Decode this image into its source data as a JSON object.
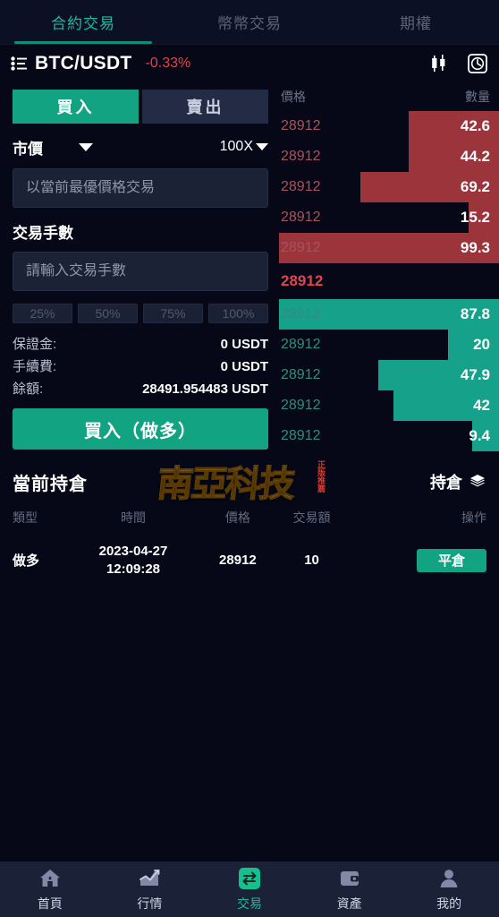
{
  "top_tabs": [
    {
      "label": "合約交易",
      "active": true
    },
    {
      "label": "幣幣交易",
      "active": false
    },
    {
      "label": "期權",
      "active": false
    }
  ],
  "symbol_header": {
    "menu_icon": "list-menu-icon",
    "symbol": "BTC/USDT",
    "change": "-0.33%",
    "change_color": "#e0454e",
    "chart_icon": "candlestick-icon",
    "history_icon": "clock-history-icon"
  },
  "order_form": {
    "buy_tab": "買入",
    "sell_tab": "賣出",
    "order_type": "市價",
    "leverage": "100X",
    "price_placeholder": "以當前最優價格交易",
    "price_value": "",
    "amount_label": "交易手數",
    "amount_placeholder": "請輸入交易手數",
    "amount_value": "",
    "percent_buttons": [
      "25%",
      "50%",
      "75%",
      "100%"
    ],
    "info": [
      {
        "label": "保證金:",
        "value": "0 USDT"
      },
      {
        "label": "手續費:",
        "value": "0 USDT"
      },
      {
        "label": "餘額:",
        "value": "28491.954483 USDT"
      }
    ],
    "submit_label": "買入（做多）",
    "accent_color": "#11a382"
  },
  "order_book": {
    "header": {
      "price": "價格",
      "amount": "數量"
    },
    "ask_color": "#9c343c",
    "bid_color": "#16a18b",
    "asks": [
      {
        "price": "28912",
        "amount": "42.6",
        "bar_pct": 41
      },
      {
        "price": "28912",
        "amount": "44.2",
        "bar_pct": 41
      },
      {
        "price": "28912",
        "amount": "69.2",
        "bar_pct": 63
      },
      {
        "price": "28912",
        "amount": "15.2",
        "bar_pct": 14
      },
      {
        "price": "28912",
        "amount": "99.3",
        "bar_pct": 100
      }
    ],
    "last_price": "28912",
    "bids": [
      {
        "price": "28912",
        "amount": "87.8",
        "bar_pct": 100
      },
      {
        "price": "28912",
        "amount": "20",
        "bar_pct": 23
      },
      {
        "price": "28912",
        "amount": "47.9",
        "bar_pct": 55
      },
      {
        "price": "28912",
        "amount": "42",
        "bar_pct": 48
      },
      {
        "price": "28912",
        "amount": "9.4",
        "bar_pct": 12
      }
    ]
  },
  "watermark": {
    "text": "南亞科技",
    "sub": "正版推薦"
  },
  "positions": {
    "title": "當前持倉",
    "right_label": "持倉",
    "right_icon": "layers-icon",
    "columns": [
      "類型",
      "時間",
      "價格",
      "交易額",
      "操作"
    ],
    "rows": [
      {
        "type": "做多",
        "date": "2023-04-27",
        "time": "12:09:28",
        "price": "28912",
        "volume": "10",
        "action": "平倉"
      }
    ]
  },
  "bottom_nav": [
    {
      "label": "首頁",
      "icon": "home-icon",
      "active": false
    },
    {
      "label": "行情",
      "icon": "chart-icon",
      "active": false
    },
    {
      "label": "交易",
      "icon": "exchange-icon",
      "active": true
    },
    {
      "label": "資產",
      "icon": "wallet-icon",
      "active": false
    },
    {
      "label": "我的",
      "icon": "person-icon",
      "active": false
    }
  ]
}
